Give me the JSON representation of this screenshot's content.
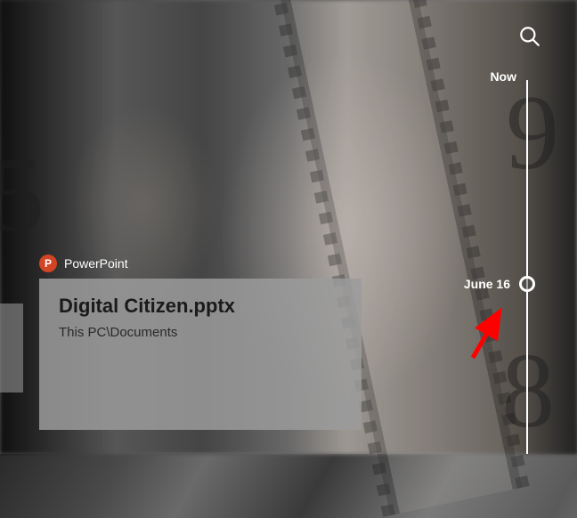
{
  "timeline": {
    "now_label": "Now",
    "date_label": "June 16"
  },
  "activity": {
    "app_name": "PowerPoint",
    "app_icon_letter": "P",
    "title": "Digital Citizen.pptx",
    "path": "This PC\\Documents"
  },
  "icons": {
    "search": "search-icon"
  },
  "colors": {
    "powerpoint": "#d14424",
    "annotation_arrow": "#ff0000"
  }
}
